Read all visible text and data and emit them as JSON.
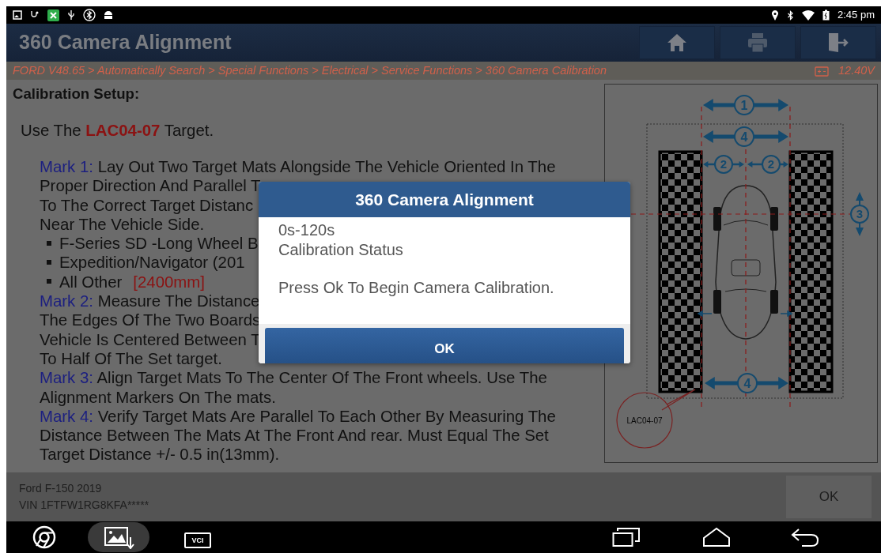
{
  "status_bar": {
    "time": "2:45 pm"
  },
  "header": {
    "title": "360 Camera Alignment"
  },
  "breadcrumb": {
    "path": "FORD V48.65 > Automatically Search > Special Functions > Electrical > Service Functions > 360 Camera Calibration",
    "voltage": "12.40V"
  },
  "content": {
    "heading": "Calibration Setup:",
    "target_prefix": "Use The",
    "target": "LAC04-07",
    "target_suffix": "Target.",
    "lines": [
      {
        "kind": "mark",
        "label": "Mark 1:",
        "text": "Lay Out Two Target Mats Alongside The Vehicle Oriented In The"
      },
      {
        "kind": "text",
        "text": "Proper Direction And Parallel T"
      },
      {
        "kind": "text",
        "text": "To The Correct Target Distanc"
      },
      {
        "kind": "text",
        "text": "Near The Vehicle Side."
      },
      {
        "kind": "bullet",
        "text": "F-Series SD -Long Wheel B"
      },
      {
        "kind": "bullet",
        "text": "Expedition/Navigator (201"
      },
      {
        "kind": "bullet",
        "text": "All Other",
        "value": "[2400mm]"
      },
      {
        "kind": "mark",
        "label": "Mark 2:",
        "text": "Measure The Distance"
      },
      {
        "kind": "text",
        "text": "The Edges Of The Two Boards"
      },
      {
        "kind": "text",
        "text": "Vehicle Is Centered Between T"
      },
      {
        "kind": "text",
        "text": "To Half Of The Set target."
      },
      {
        "kind": "mark",
        "label": "Mark 3:",
        "text": "Align Target Mats To The Center Of The Front wheels. Use The"
      },
      {
        "kind": "text",
        "text": "Alignment Markers On The mats."
      },
      {
        "kind": "mark",
        "label": "Mark 4:",
        "text": "Verify Target Mats Are Parallel To Each Other By Measuring The"
      },
      {
        "kind": "text",
        "text": "Distance Between The Mats At The Front And rear. Must Equal The Set"
      },
      {
        "kind": "text",
        "text": "Target Distance +/- 0.5 in(13mm)."
      }
    ]
  },
  "diagram": {
    "labels": [
      "1",
      "4",
      "2",
      "2",
      "3",
      "4"
    ],
    "target_label": "LAC04-07"
  },
  "dialog": {
    "title": "360 Camera Alignment",
    "lines": [
      "0s-120s",
      "Calibration Status"
    ],
    "message": "Press Ok To Begin Camera Calibration.",
    "button": "OK"
  },
  "footer": {
    "vehicle": "Ford F-150 2019",
    "vin": "VIN 1FTFW1RG8KFA*****",
    "button": "OK"
  },
  "nav_bar": {
    "vci_label": "VCI"
  }
}
